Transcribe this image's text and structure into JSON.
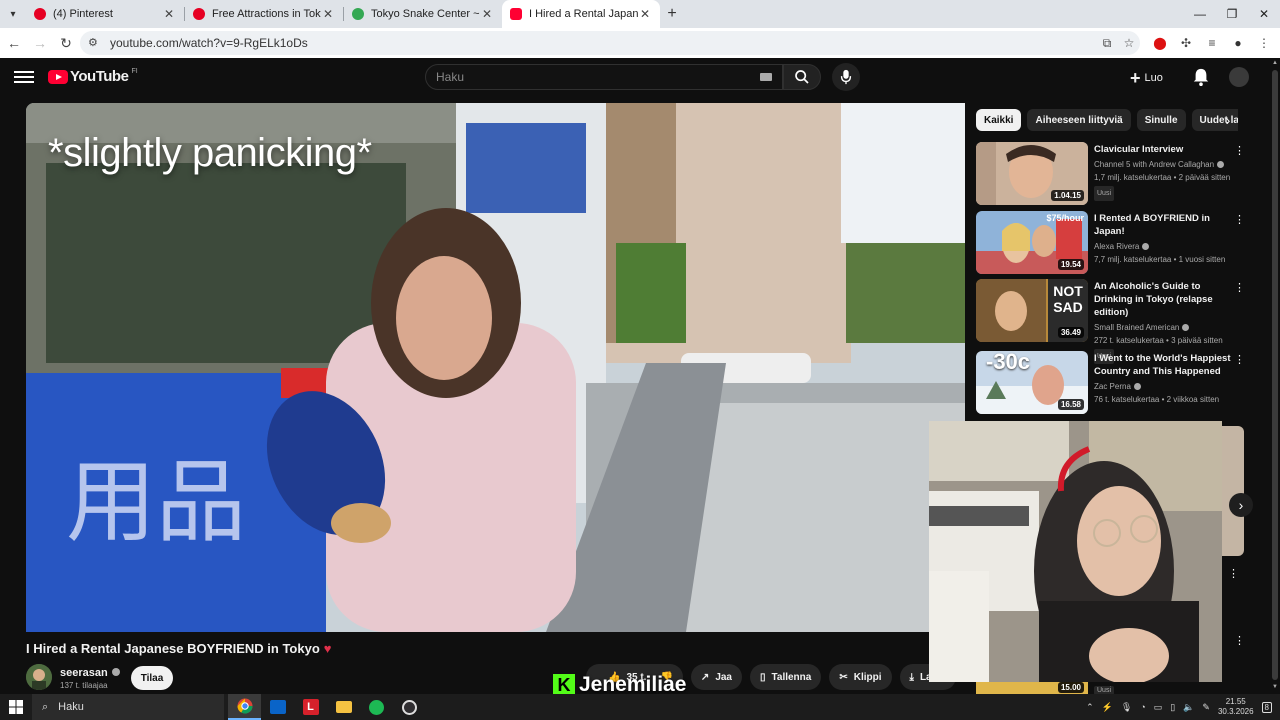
{
  "browser": {
    "tabs": [
      {
        "title": "(4) Pinterest",
        "favicon_color": "#e60023",
        "active": false
      },
      {
        "title": "Free Attractions in Tokyo Itinerar",
        "favicon_color": "#e60023",
        "active": false
      },
      {
        "title": "Tokyo Snake Center ~Cafe & Sna",
        "favicon_color": "#34a853",
        "active": false
      },
      {
        "title": "I Hired a Rental Japanese BOYFRI",
        "favicon_color": "#ff0033",
        "active": true
      }
    ],
    "url": "youtube.com/watch?v=9-RgELk1oDs"
  },
  "youtube": {
    "logo_text": "YouTube",
    "region": "FI",
    "search_placeholder": "Haku",
    "create_label": "Luo",
    "video": {
      "overlay_caption": "*slightly panicking*",
      "title": "I Hired a Rental Japanese BOYFRIEND in Tokyo",
      "title_emoji": "♥",
      "channel": "seerasan",
      "subscribers": "137 t. tilaajaa",
      "subscribe_label": "Tilaa",
      "like_count": "35 t.",
      "share_label": "Jaa",
      "save_label": "Tallenna",
      "clip_label": "Klippi",
      "download_label": "Lataa"
    },
    "chips": [
      "Kaikki",
      "Aiheeseen liittyviä",
      "Sinulle",
      "Uudet la"
    ],
    "recommendations": [
      {
        "title": "Clavicular Interview",
        "channel": "Channel 5 with Andrew Callaghan",
        "verified": true,
        "meta": "1,7 milj. katselukertaa • 2 päivää sitten",
        "badge": "Uusi",
        "duration": "1.04.15",
        "thumb_color": "#d9c3b0"
      },
      {
        "title": "I Rented A BOYFRIEND in Japan!",
        "channel": "Alexa Rivera",
        "verified": true,
        "meta": "7,7 milj. katselukertaa • 1 vuosi sitten",
        "badge": "",
        "duration": "19.54",
        "thumb_color": "#8fb3d9",
        "thumb_text": "$75/hour"
      },
      {
        "title": "An Alcoholic's Guide to Drinking in Tokyo (relapse edition)",
        "channel": "Small Brained American",
        "verified": true,
        "meta": "272 t. katselukertaa • 3 päivää sitten",
        "badge": "Uusi",
        "duration": "36.49",
        "thumb_color": "#b8893a",
        "thumb_text": "NOT SAD"
      },
      {
        "title": "I Went to the World's Happiest Country and This Happened",
        "channel": "Zac Perna",
        "verified": true,
        "meta": "76 t. katselukertaa • 2 viikkoa sitten",
        "badge": "",
        "duration": "16.58",
        "thumb_color": "#c7d7e8",
        "thumb_text": "-30c"
      }
    ],
    "partial_item": {
      "duration": "15.00",
      "badge": "Uusi"
    }
  },
  "stream": {
    "platform_icon": "kick-logo",
    "streamer": "Jenemiliae"
  },
  "taskbar": {
    "search_placeholder": "Haku",
    "time": "21.55",
    "date": "30.3.2026",
    "notifications": "8"
  }
}
